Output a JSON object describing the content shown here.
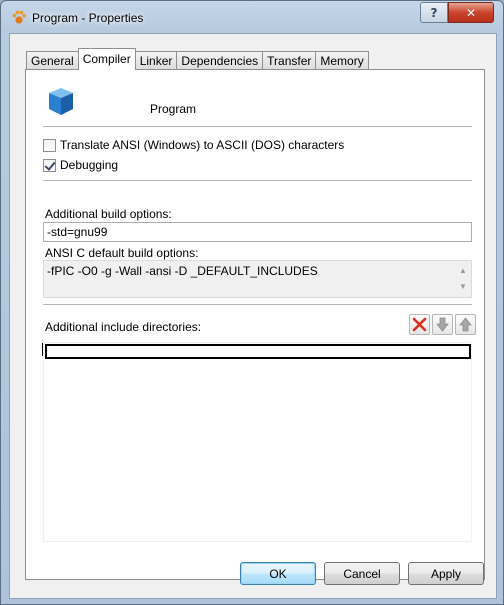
{
  "window": {
    "title": "Program - Properties",
    "help_glyph": "?",
    "close_glyph": "✕"
  },
  "tabs": [
    {
      "label": "General"
    },
    {
      "label": "Compiler"
    },
    {
      "label": "Linker"
    },
    {
      "label": "Dependencies"
    },
    {
      "label": "Transfer"
    },
    {
      "label": "Memory"
    }
  ],
  "active_tab": "Compiler",
  "program": {
    "name": "Program"
  },
  "options": {
    "translate_ansi": {
      "label": "Translate ANSI (Windows) to ASCII (DOS) characters",
      "checked": false
    },
    "debugging": {
      "label": "Debugging",
      "checked": true
    }
  },
  "additional_build": {
    "label": "Additional build options:",
    "value": "-std=gnu99"
  },
  "default_build": {
    "label": "ANSI C default build options:",
    "value": "-fPIC -O0 -g -Wall -ansi -D _DEFAULT_INCLUDES",
    "scroll_up": "▲",
    "scroll_down": "▼"
  },
  "include_dirs": {
    "label": "Additional include directories:",
    "value": ""
  },
  "buttons": {
    "ok": "OK",
    "cancel": "Cancel",
    "apply": "Apply"
  }
}
